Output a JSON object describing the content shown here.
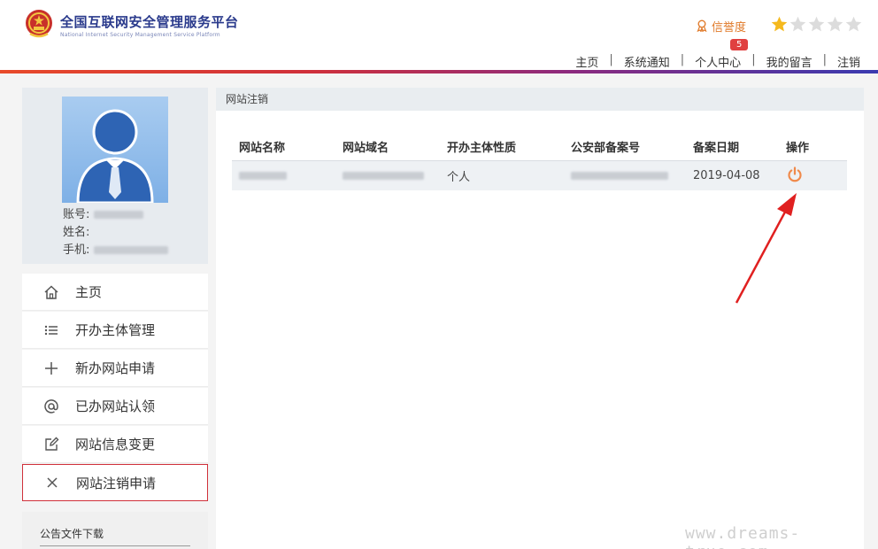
{
  "header": {
    "title_cn": "全国互联网安全管理服务平台",
    "title_en": "National Internet Security Management Service Platform",
    "credit_label": "信誉度",
    "stars_filled": 1,
    "stars_total": 5,
    "nav": [
      {
        "label": "主页"
      },
      {
        "label": "系统通知"
      },
      {
        "label": "个人中心",
        "badge": "5"
      },
      {
        "label": "我的留言"
      },
      {
        "label": "注销"
      }
    ]
  },
  "profile": {
    "account_label": "账号:",
    "name_label": "姓名:",
    "phone_label": "手机:"
  },
  "menu": [
    {
      "label": "主页",
      "icon": "home-icon"
    },
    {
      "label": "开办主体管理",
      "icon": "list-icon"
    },
    {
      "label": "新办网站申请",
      "icon": "plus-icon"
    },
    {
      "label": "已办网站认领",
      "icon": "at-icon"
    },
    {
      "label": "网站信息变更",
      "icon": "edit-icon"
    },
    {
      "label": "网站注销申请",
      "icon": "close-icon",
      "active": true
    }
  ],
  "notice": {
    "title": "公告文件下载"
  },
  "panel": {
    "title": "网站注销",
    "columns": [
      "网站名称",
      "网站域名",
      "开办主体性质",
      "公安部备案号",
      "备案日期",
      "操作"
    ],
    "rows": [
      {
        "subject_type": "个人",
        "date": "2019-04-08",
        "action_icon": "power-icon"
      }
    ]
  },
  "watermark": "www.dreams-true.com",
  "colors": {
    "brand_blue": "#2a3a8c",
    "credit_orange": "#e07a2a",
    "star_gold": "#f5b91e",
    "active_border": "#d0303a",
    "power_orange": "#f08a4b",
    "badge_red": "#e04040"
  }
}
